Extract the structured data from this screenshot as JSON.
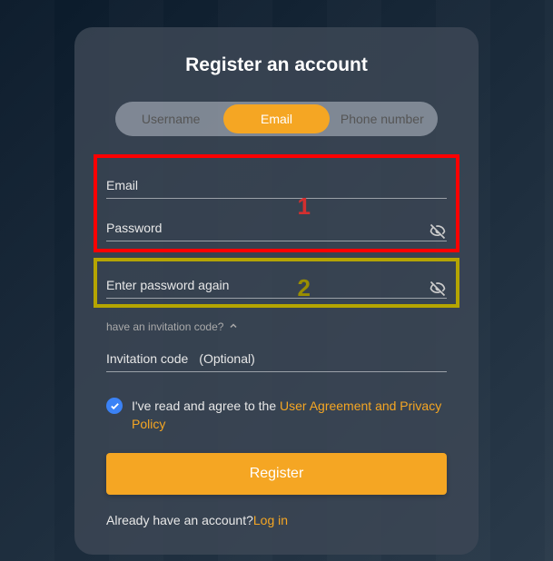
{
  "title": "Register an account",
  "tabs": {
    "username": "Username",
    "email": "Email",
    "phone": "Phone number"
  },
  "fields": {
    "email_label": "Email",
    "password_label": "Password",
    "confirm_label": "Enter password again",
    "invitation_toggle": "have an invitation code?",
    "invitation_label": "Invitation code",
    "invitation_optional": "(Optional)"
  },
  "agreement": {
    "prefix": "I've read and agree to the ",
    "link": "User Agreement and Privacy Policy"
  },
  "register_button": "Register",
  "login_prefix": "Already have an account?",
  "login_link": "Log in",
  "annotations": {
    "marker1": "1",
    "marker2": "2"
  }
}
